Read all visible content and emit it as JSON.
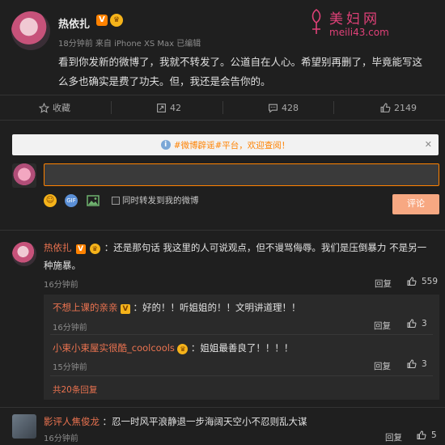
{
  "post": {
    "username": "热依扎",
    "verified_badge": "V",
    "member_badge": "♛",
    "meta": "18分钟前  来自 iPhone XS Max  已编辑",
    "text": "看到你发新的微博了，我就不转发了。公道自在人心。希望别再删了，毕竟能写这么多也确实是费了功夫。但，我还是会告你的。"
  },
  "watermark": {
    "title": "美妇网",
    "url": "meili43.com"
  },
  "actions": {
    "favorite_label": "收藏",
    "repost_count": "42",
    "comment_count": "428",
    "like_count": "2149"
  },
  "notice": {
    "text": "#微博辟谣#平台，欢迎查阅！",
    "close": "✕"
  },
  "composer": {
    "input_value": "",
    "repost_checkbox_label": "同时转发到我的微博",
    "submit_label": "评论",
    "gif_label": "GIF"
  },
  "comments": [
    {
      "username": "热依扎",
      "text": "：还是那句话 我这里的人可说观点，但不谩骂侮辱。我们是压倒暴力 不是另一种施暴。",
      "time": "16分钟前",
      "reply_label": "回复",
      "like_count": "559",
      "replies": [
        {
          "username": "不想上课的亲亲",
          "text": "：好的！！听姐姐的！！文明讲道理！！",
          "time": "16分钟前",
          "reply_label": "回复",
          "like_count": "3"
        },
        {
          "username": "小束小束屋实很酷_coolcools",
          "text": "：姐姐最善良了！！！！",
          "time": "15分钟前",
          "reply_label": "回复",
          "like_count": "3"
        }
      ],
      "more_replies": "共20条回复"
    },
    {
      "username": "影评人焦俊龙",
      "text": "：忍一时风平浪静退一步海阔天空小不忍则乱大谋",
      "time": "16分钟前",
      "reply_label": "回复",
      "like_count": "5"
    }
  ],
  "colors": {
    "accent": "#ff8200",
    "username_link": "#eb7350",
    "background": "#1f1f1f"
  }
}
